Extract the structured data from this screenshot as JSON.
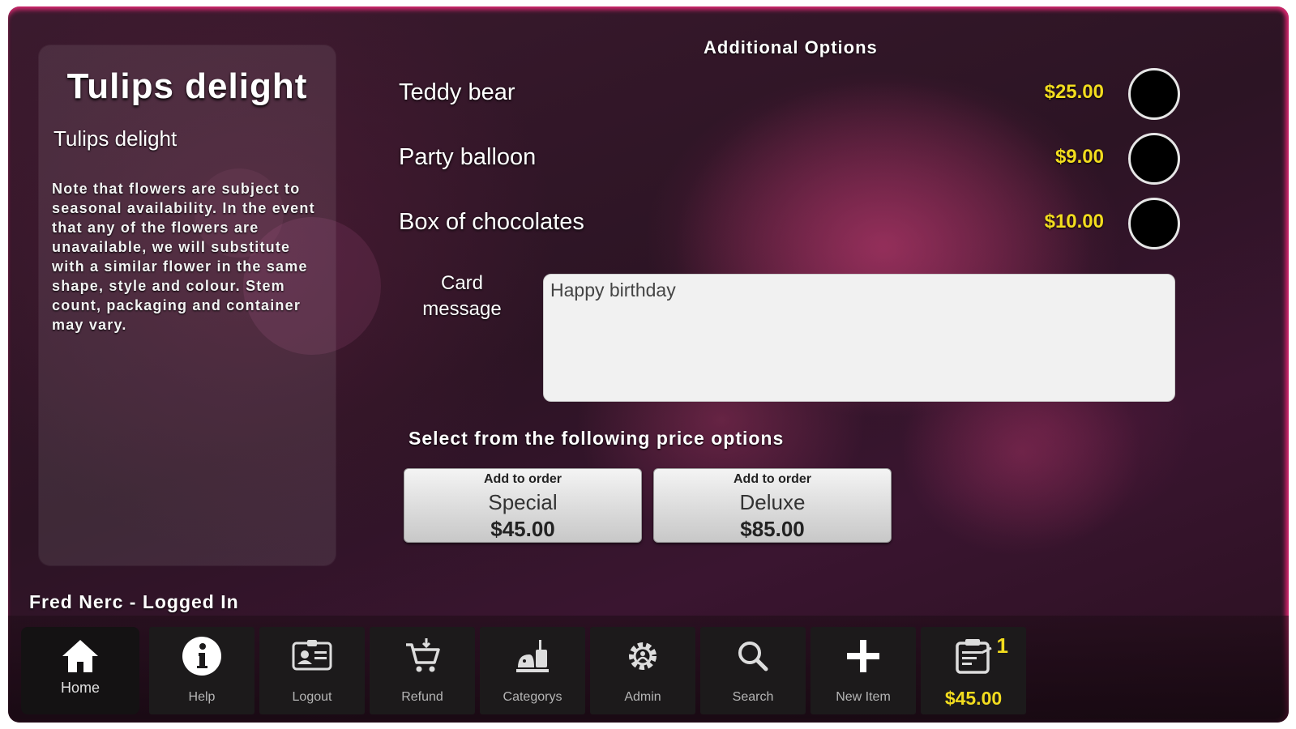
{
  "product": {
    "title": "Tulips delight",
    "subtitle": "Tulips delight",
    "note": "Note that flowers are subject to seasonal availability. In the event that any of the flowers are unavailable, we will substitute with a similar flower in the same shape, style and colour. Stem count, packaging and container may vary."
  },
  "options": {
    "header": "Additional Options",
    "items": [
      {
        "label": "Teddy bear",
        "price": "$25.00",
        "selected": false
      },
      {
        "label": "Party balloon",
        "price": "$9.00",
        "selected": false
      },
      {
        "label": "Box of chocolates",
        "price": "$10.00",
        "selected": false
      }
    ]
  },
  "card_message": {
    "label": "Card message",
    "value": "Happy birthday"
  },
  "pricing": {
    "prompt": "Select from the following price options",
    "buttons": [
      {
        "action": "Add to order",
        "tier": "Special",
        "price": "$45.00"
      },
      {
        "action": "Add to order",
        "tier": "Deluxe",
        "price": "$85.00"
      }
    ]
  },
  "user": {
    "status": "Fred Nerc - Logged In"
  },
  "toolbar": {
    "items": [
      {
        "label": "Home",
        "icon": "home-icon"
      },
      {
        "label": "Help",
        "icon": "info-icon"
      },
      {
        "label": "Logout",
        "icon": "id-card-icon"
      },
      {
        "label": "Refund",
        "icon": "cart-return-icon"
      },
      {
        "label": "Categorys",
        "icon": "categories-icon"
      },
      {
        "label": "Admin",
        "icon": "gear-icon"
      },
      {
        "label": "Search",
        "icon": "search-icon"
      },
      {
        "label": "New Item",
        "icon": "plus-icon"
      }
    ],
    "cart": {
      "count": "1",
      "total": "$45.00",
      "icon": "order-clipboard-icon"
    }
  },
  "colors": {
    "accent": "#d4286e",
    "price": "#f2dc1e"
  }
}
